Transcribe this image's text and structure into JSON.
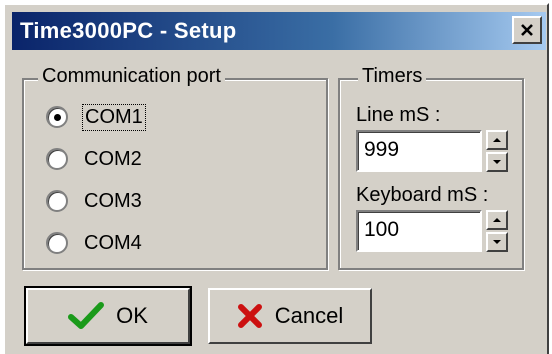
{
  "window": {
    "title": "Time3000PC - Setup"
  },
  "communication": {
    "legend": "Communication port",
    "ports": [
      {
        "label": "COM1",
        "selected": true
      },
      {
        "label": "COM2",
        "selected": false
      },
      {
        "label": "COM3",
        "selected": false
      },
      {
        "label": "COM4",
        "selected": false
      }
    ]
  },
  "timers": {
    "legend": "Timers",
    "line_label": "Line mS :",
    "line_value": "999",
    "keyboard_label": "Keyboard mS :",
    "keyboard_value": "100"
  },
  "buttons": {
    "ok_label": "OK",
    "cancel_label": "Cancel"
  },
  "colors": {
    "ok_check": "#1a9a1a",
    "cancel_x": "#cc1010",
    "title_start": "#0a246a"
  },
  "icons": {
    "close": "close-icon",
    "ok": "checkmark-icon",
    "cancel": "x-icon",
    "spin_up": "arrow-up-icon",
    "spin_down": "arrow-down-icon"
  }
}
